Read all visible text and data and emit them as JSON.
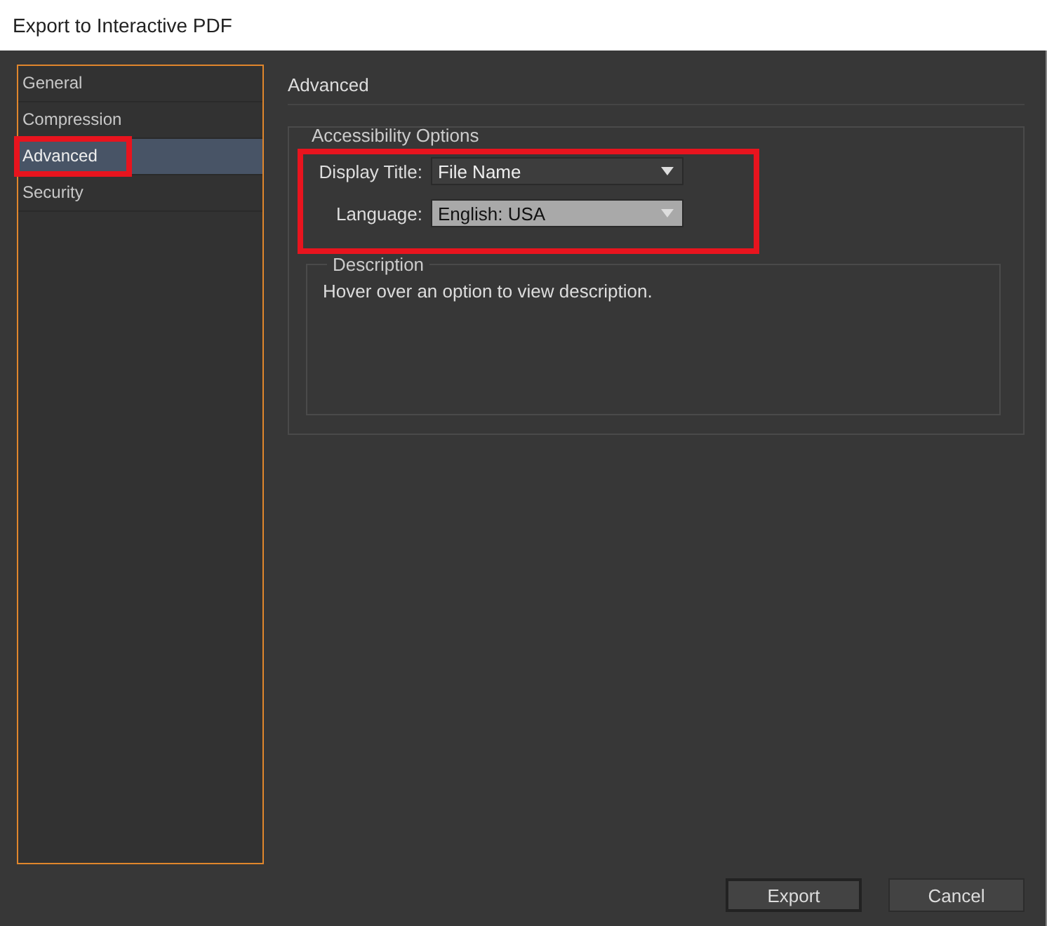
{
  "window": {
    "title": "Export to Interactive PDF"
  },
  "sidebar": {
    "items": [
      {
        "label": "General",
        "selected": false,
        "highlighted": false
      },
      {
        "label": "Compression",
        "selected": false,
        "highlighted": false
      },
      {
        "label": "Advanced",
        "selected": true,
        "highlighted": true
      },
      {
        "label": "Security",
        "selected": false,
        "highlighted": false
      }
    ]
  },
  "panel": {
    "title": "Advanced",
    "group": {
      "legend": "Accessibility Options",
      "highlighted": true,
      "fields": [
        {
          "label": "Display Title:",
          "value": "File Name",
          "focused": false
        },
        {
          "label": "Language:",
          "value": "English: USA",
          "focused": true
        }
      ],
      "description": {
        "legend": "Description",
        "text": "Hover over an option to view description."
      }
    }
  },
  "buttons": [
    {
      "label": "Export",
      "default": true
    },
    {
      "label": "Cancel",
      "default": false
    }
  ]
}
